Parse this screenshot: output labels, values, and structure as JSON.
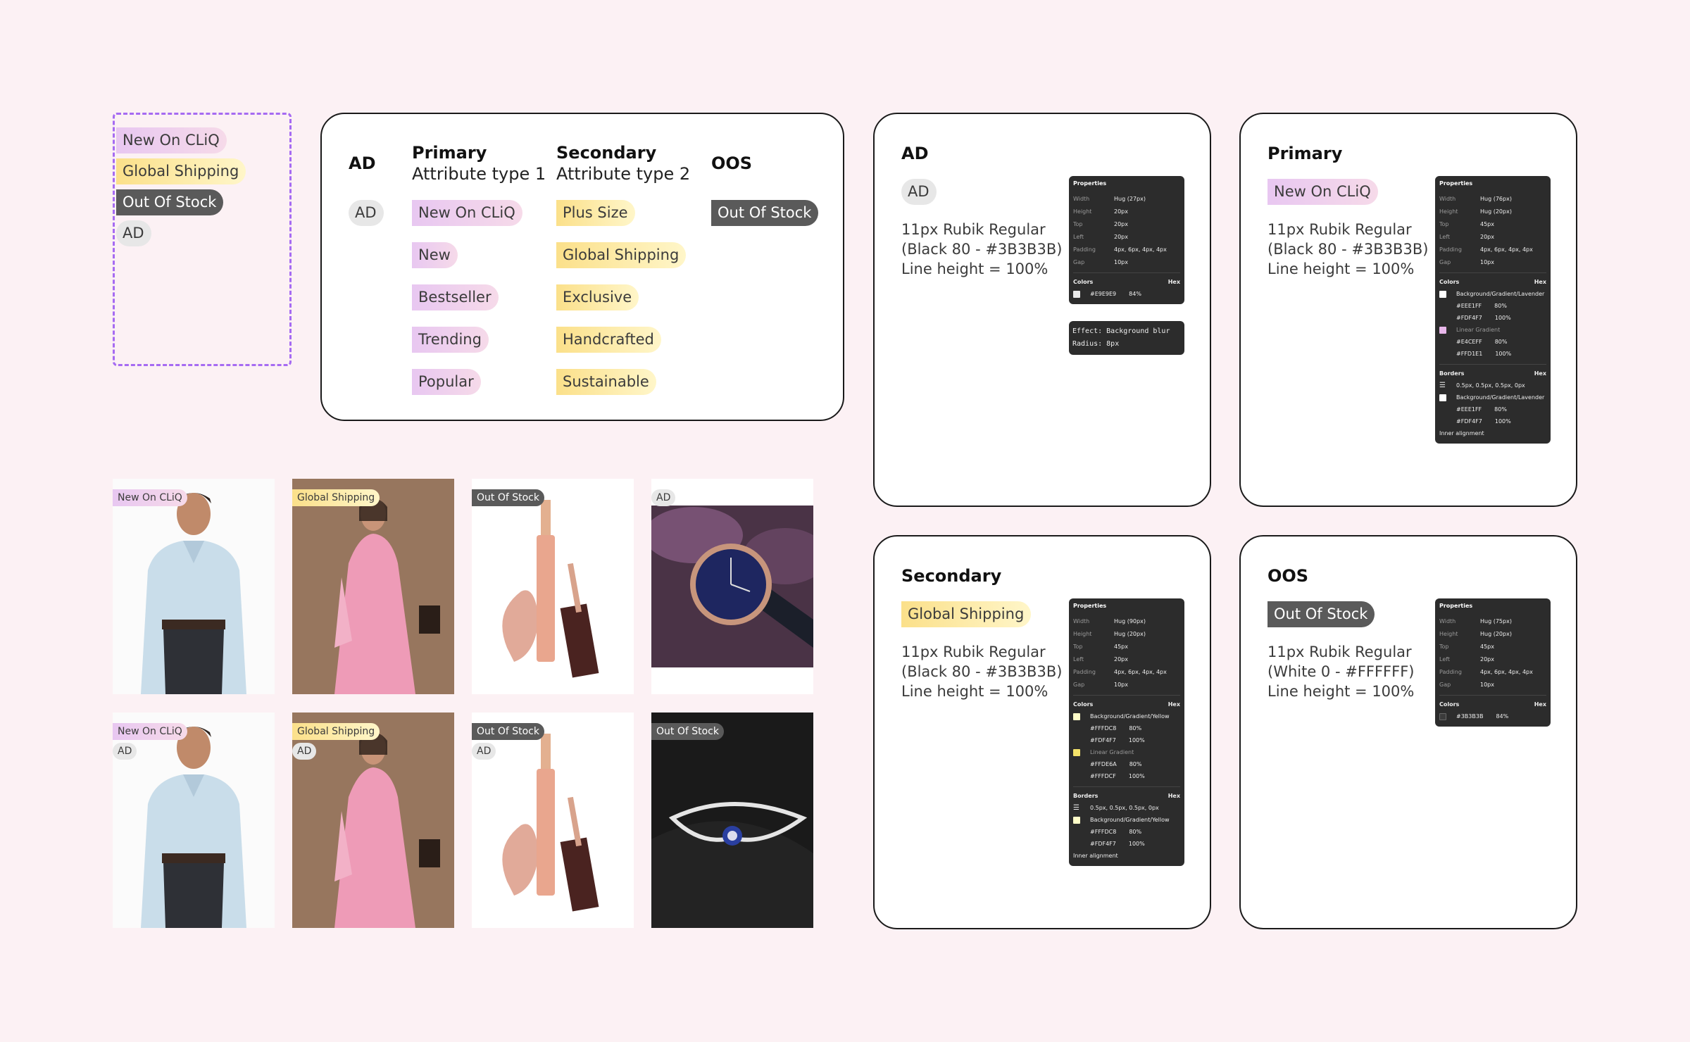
{
  "variants": [
    {
      "label": "New On CLiQ",
      "kind": "primary"
    },
    {
      "label": "Global Shipping",
      "kind": "secondary"
    },
    {
      "label": "Out Of Stock",
      "kind": "oos"
    },
    {
      "label": "AD",
      "kind": "ad"
    }
  ],
  "overview": {
    "ad": {
      "head": "AD",
      "tags": [
        "AD"
      ]
    },
    "primary": {
      "head": "Primary",
      "sub": "Attribute type 1",
      "tags": [
        "New On CLiQ",
        "New",
        "Bestseller",
        "Trending",
        "Popular"
      ]
    },
    "secondary": {
      "head": "Secondary",
      "sub": "Attribute type 2",
      "tags": [
        "Plus Size",
        "Global Shipping",
        "Exclusive",
        "Handcrafted",
        "Sustainable"
      ]
    },
    "oos": {
      "head": "OOS",
      "tags": [
        "Out Of Stock"
      ]
    }
  },
  "tiles": [
    {
      "labels": [
        {
          "text": "New On CLiQ",
          "kind": "primary"
        }
      ],
      "image": "man-in-blue-shirt"
    },
    {
      "labels": [
        {
          "text": "Global Shipping",
          "kind": "secondary"
        }
      ],
      "image": "woman-in-pink-dress"
    },
    {
      "labels": [
        {
          "text": "Out Of Stock",
          "kind": "oos"
        }
      ],
      "image": "lip-gloss"
    },
    {
      "labels": [
        {
          "text": "AD",
          "kind": "ad"
        }
      ],
      "image": "wrist-watch"
    },
    {
      "labels": [
        {
          "text": "New On CLiQ",
          "kind": "primary"
        },
        {
          "text": "AD",
          "kind": "ad"
        }
      ],
      "image": "man-in-blue-shirt"
    },
    {
      "labels": [
        {
          "text": "Global Shipping",
          "kind": "secondary"
        },
        {
          "text": "AD",
          "kind": "ad"
        }
      ],
      "image": "woman-in-pink-dress"
    },
    {
      "labels": [
        {
          "text": "Out Of Stock",
          "kind": "oos"
        },
        {
          "text": "AD",
          "kind": "ad"
        }
      ],
      "image": "lip-gloss"
    },
    {
      "labels": [
        {
          "text": "Out Of Stock",
          "kind": "oos"
        }
      ],
      "image": "bracelet"
    }
  ],
  "specs": {
    "ad": {
      "title": "AD",
      "tag": "AD",
      "desc": [
        "11px Rubik Regular",
        "(Black 80 - #3B3B3B)",
        "Line height = 100%"
      ],
      "props": [
        [
          "Width",
          "Hug (27px)"
        ],
        [
          "Height",
          "20px"
        ],
        [
          "Top",
          "20px"
        ],
        [
          "Left",
          "20px"
        ],
        [
          "Padding",
          "4px, 6px, 4px, 4px"
        ],
        [
          "Gap",
          "10px"
        ]
      ],
      "colors_label": "Colors",
      "hex_label": "Hex",
      "color_rows": [
        {
          "swatch": "#E9E9E9",
          "value": "#E9E9E9",
          "pct": "84%"
        }
      ],
      "effect": [
        "Effect: Background blur",
        "Radius: 8px"
      ]
    },
    "primary": {
      "title": "Primary",
      "tag": "New On CLiQ",
      "desc": [
        "11px Rubik Regular",
        "(Black 80 - #3B3B3B)",
        "Line height = 100%"
      ],
      "props": [
        [
          "Width",
          "Hug (76px)"
        ],
        [
          "Height",
          "Hug (20px)"
        ],
        [
          "Top",
          "45px"
        ],
        [
          "Left",
          "20px"
        ],
        [
          "Padding",
          "4px, 6px, 4px, 4px"
        ],
        [
          "Gap",
          "10px"
        ]
      ],
      "colors_label": "Colors",
      "hex_label": "Hex",
      "fill_name": "Background/Gradient/Lavender",
      "fill_stops": [
        [
          "#EEE1FF",
          "80%"
        ],
        [
          "#FDF4F7",
          "100%"
        ]
      ],
      "grad_name": "Linear Gradient",
      "grad_stops": [
        [
          "#E4CEFF",
          "80%"
        ],
        [
          "#FFD1E1",
          "100%"
        ]
      ],
      "borders_label": "Borders",
      "border_width": "0.5px, 0.5px, 0.5px, 0px",
      "border_name": "Background/Gradient/Lavender",
      "border_stops": [
        [
          "#EEE1FF",
          "80%"
        ],
        [
          "#FDF4F7",
          "100%"
        ]
      ],
      "inner": "Inner alignment"
    },
    "secondary": {
      "title": "Secondary",
      "tag": "Global Shipping",
      "desc": [
        "11px Rubik Regular",
        "(Black 80 - #3B3B3B)",
        "Line height = 100%"
      ],
      "props": [
        [
          "Width",
          "Hug (90px)"
        ],
        [
          "Height",
          "Hug (20px)"
        ],
        [
          "Top",
          "45px"
        ],
        [
          "Left",
          "20px"
        ],
        [
          "Padding",
          "4px, 6px, 4px, 4px"
        ],
        [
          "Gap",
          "10px"
        ]
      ],
      "colors_label": "Colors",
      "hex_label": "Hex",
      "fill_name": "Background/Gradient/Yellow",
      "fill_stops": [
        [
          "#FFFDC8",
          "80%"
        ],
        [
          "#FDF4F7",
          "100%"
        ]
      ],
      "grad_name": "Linear Gradient",
      "grad_stops": [
        [
          "#FFDE6A",
          "80%"
        ],
        [
          "#FFFDCF",
          "100%"
        ]
      ],
      "borders_label": "Borders",
      "border_width": "0.5px, 0.5px, 0.5px, 0px",
      "border_name": "Background/Gradient/Yellow",
      "border_stops": [
        [
          "#FFFDC8",
          "80%"
        ],
        [
          "#FDF4F7",
          "100%"
        ]
      ],
      "inner": "Inner alignment"
    },
    "oos": {
      "title": "OOS",
      "tag": "Out Of Stock",
      "desc": [
        "11px Rubik Regular",
        "(White 0 - #FFFFFF)",
        "Line height = 100%"
      ],
      "props": [
        [
          "Width",
          "Hug (75px)"
        ],
        [
          "Height",
          "Hug (20px)"
        ],
        [
          "Top",
          "45px"
        ],
        [
          "Left",
          "20px"
        ],
        [
          "Padding",
          "4px, 6px, 4px, 4px"
        ],
        [
          "Gap",
          "10px"
        ]
      ],
      "colors_label": "Colors",
      "hex_label": "Hex",
      "color_rows": [
        {
          "swatch": "#3B3B3B",
          "value": "#3B3B3B",
          "pct": "84%"
        }
      ]
    }
  },
  "panel_title": "Properties",
  "colors": {
    "primary_a": "#E8C7F1",
    "secondary_a": "#FBE08A",
    "oos": "#5A5A5A",
    "ad": "#E7E7E7",
    "dash": "#A66BF2",
    "bg": "#FCF1F4"
  }
}
